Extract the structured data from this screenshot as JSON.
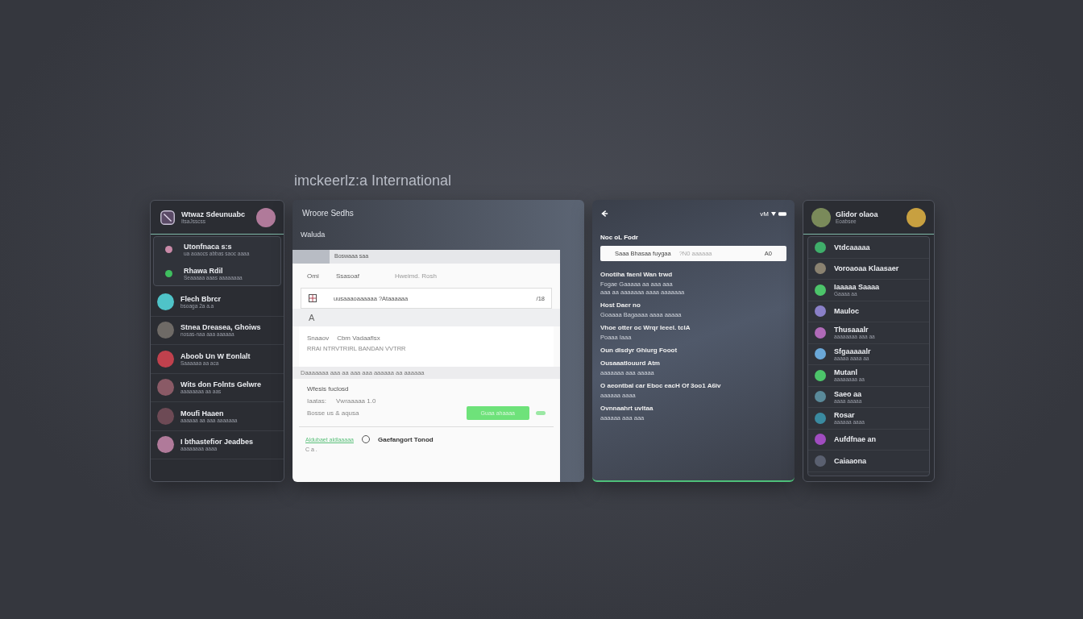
{
  "heading": "imckeerlz:a International",
  "left_panel": {
    "header": {
      "title": "Wtwaz Sdeunuabc",
      "subtitle": "ItsaJsscss"
    },
    "group": [
      {
        "title": "Utonfnaca s:s",
        "subtitle": "ua aoaocs abbas saoc aaaa",
        "color": "#c98aa8"
      },
      {
        "title": "Rhawa Rdil",
        "subtitle": "Seaaaaa aaas aaaaaaaa",
        "color": "#3fbf5f"
      }
    ],
    "items": [
      {
        "title": "Flech Bbrcr",
        "subtitle": "bsoaga 2a a.a",
        "color": "#4fc3c8"
      },
      {
        "title": "Stnea Dreasea, Ghoiws",
        "subtitle": "nosas-naa aaa aaaaaa",
        "color": "#6e6a66"
      },
      {
        "title": "Aboob Un W Eonlalt",
        "subtitle": "Saaaaaa aa aca",
        "color": "#c0414d"
      },
      {
        "title": "Wits don Folnts Gelwre",
        "subtitle": "aaaaaaaa aa aas",
        "color": "#8a5a66"
      },
      {
        "title": "Moufi Haaen",
        "subtitle": "aaaaaa aa aaa aaaaaaa",
        "color": "#6d4a55"
      },
      {
        "title": "I bthastefior Jeadbes",
        "subtitle": "aaaaaaaa aaaa",
        "color": "#b07a9a"
      }
    ]
  },
  "form_panel": {
    "title": "Wroore Sedhs",
    "section": "Waluda",
    "table_header": "Boswaaa saa",
    "row_label": "Omi",
    "fields": [
      "Ssasoaf",
      "Hweimd. Rosh"
    ],
    "input": {
      "value": "uusaaaoaaaaaa ?Ataaaaaa",
      "suffix": "/18"
    },
    "letter": "A",
    "card": {
      "label": "Snaaov",
      "title": "Cbm Vadaaflsx",
      "detail": "RRAI  NTRVTRIRL  BANDAN  VVTRR"
    },
    "note": "Daaaaaaa aaa aa aaa aaa aaaaaa aa aaaaaa",
    "details": {
      "title": "Wfesis fuclosd",
      "version_label": "Iaatas:",
      "version": "Vwraaaaa 1.0",
      "info": "Bosse us & aqusa"
    },
    "button": "Guaa ahaaaa",
    "toggle": {
      "on": true
    },
    "link": "Aldubaet aldlaaaaa",
    "radio": {
      "label": "Gaefangort  Tonod",
      "selected": false
    },
    "footer": "C a ."
  },
  "phone_panel": {
    "status": "vM",
    "title": "Noc oL Fodr",
    "search": {
      "value": "Saaa Bhasaa fuygaa",
      "hint": "?N0  aaaaaa",
      "count": "A0"
    },
    "sections": [
      {
        "title": "Onotiha faenl Wan trwd",
        "lines": [
          "Fogae Gaaaaa  aa  aaa aaa",
          "aaa aa  aaaaaaa aaaa aaaaaaa"
        ]
      },
      {
        "title": "Host Daer no",
        "lines": [
          "Goaaaa Bagaaaa aaaa aaaaa"
        ]
      },
      {
        "title": "Vhoe otter oc Wrqr Ieeel. tcIA",
        "lines": [
          "Poaaa Iaaa"
        ]
      },
      {
        "title": "Oun dlsdyr Ghiurg Fooot"
      },
      {
        "title": "Ousaaatlouurd Atm",
        "lines": [
          "aaaaaaa aaa aaaaa"
        ]
      },
      {
        "title": "O  aeontbal car Eboc eacH Of 3oo1 A6iv",
        "lines": [
          "aaaaaa aaaa"
        ]
      },
      {
        "title": "Ovnnaahrt uvltaa",
        "lines": [
          "aaaaaa aaa aaa"
        ]
      }
    ]
  },
  "right_panel": {
    "header": {
      "title": "Glidor olaoa",
      "subtitle": "Eoabsee"
    },
    "items": [
      {
        "title": "Vtdcaaaaa",
        "color": "#3fae6a"
      },
      {
        "title": "Voroaoaa Klaasaer",
        "color": "#8a8270"
      },
      {
        "title": "Iaaaaa Saaaa",
        "subtitle": "Gaaaa aa",
        "color": "#4cc46a"
      },
      {
        "title": "Mauloc",
        "color": "#8a80c8"
      },
      {
        "title": "Thusaaalr",
        "subtitle": "aaaaaaaa aaa aa",
        "color": "#b06ab8"
      },
      {
        "title": "Sfgaaaaalr",
        "subtitle": "aaaaa aaaa aa",
        "color": "#6aa8d8"
      },
      {
        "title": "Mutanl",
        "subtitle": "aaaaaaaa aa",
        "color": "#4cc46a"
      },
      {
        "title": "Saeo aa",
        "subtitle": "aaaa aaaaa",
        "color": "#5a8a9a"
      },
      {
        "title": "Rosar",
        "subtitle": "aaaaaa aaaa",
        "color": "#3a8aa0"
      },
      {
        "title": "Aufdfnae an",
        "color": "#a04cc0"
      },
      {
        "title": "Caiaaona",
        "color": "#5a6070"
      }
    ]
  }
}
